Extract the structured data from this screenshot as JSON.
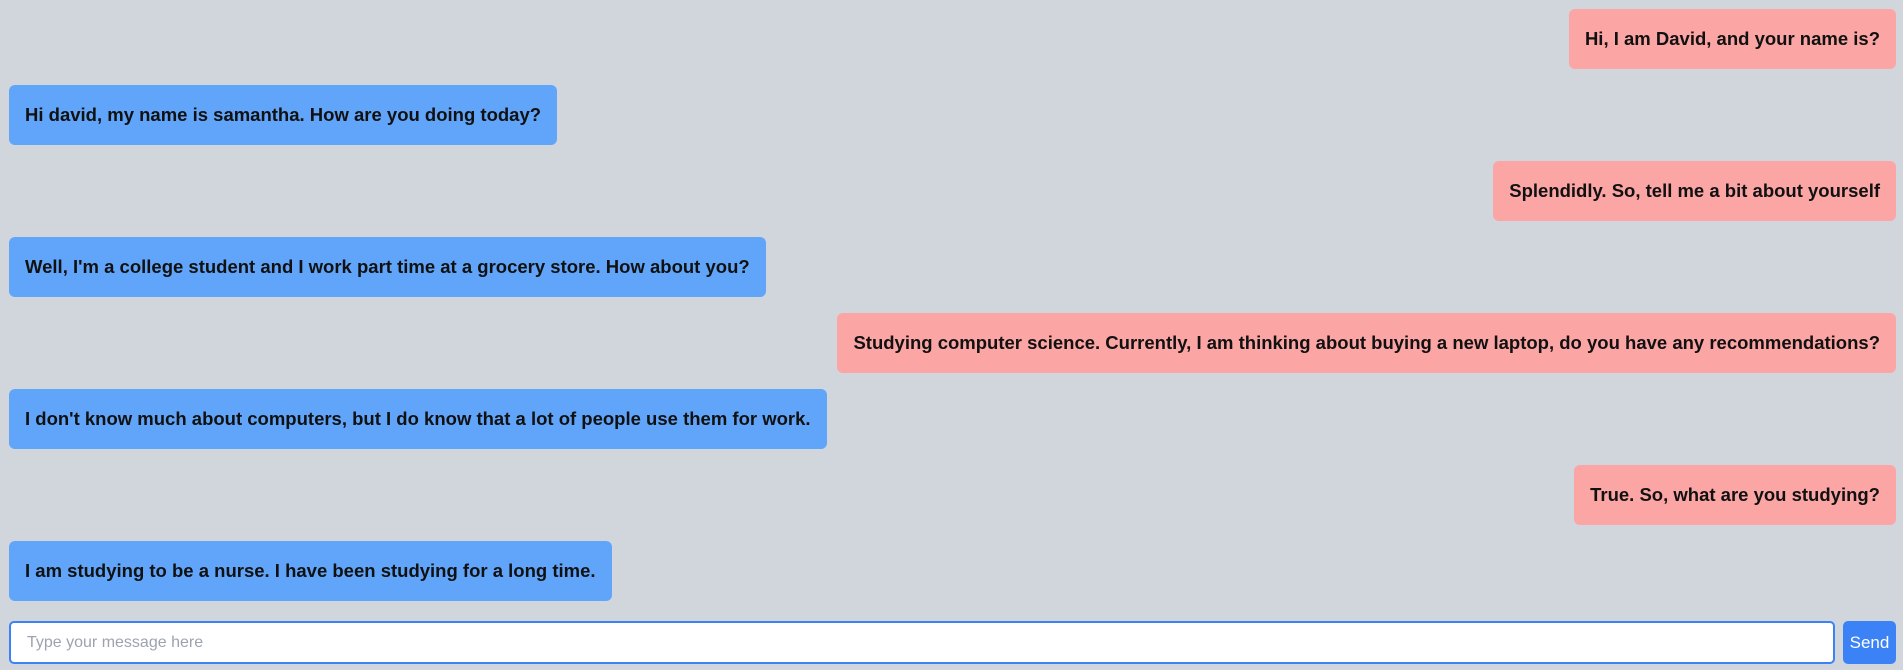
{
  "colors": {
    "background": "#d1d5dc",
    "user_bubble": "#fca5a5",
    "bot_bubble": "#60a5fa",
    "accent": "#3b82f6"
  },
  "messages": [
    {
      "sender": "user",
      "text": "Hi, I am David, and your name is?"
    },
    {
      "sender": "bot",
      "text": "Hi david, my name is samantha. How are you doing today?"
    },
    {
      "sender": "user",
      "text": "Splendidly. So, tell me a bit about yourself"
    },
    {
      "sender": "bot",
      "text": "Well, I'm a college student and I work part time at a grocery store. How about you?"
    },
    {
      "sender": "user",
      "text": "Studying computer science. Currently, I am thinking about buying a new laptop, do you have any recommendations?"
    },
    {
      "sender": "bot",
      "text": "I don't know much about computers, but I do know that a lot of people use them for work."
    },
    {
      "sender": "user",
      "text": "True. So, what are you studying?"
    },
    {
      "sender": "bot",
      "text": "I am studying to be a nurse. I have been studying for a long time."
    }
  ],
  "composer": {
    "value": "",
    "placeholder": "Type your message here",
    "send_label": "Send"
  }
}
